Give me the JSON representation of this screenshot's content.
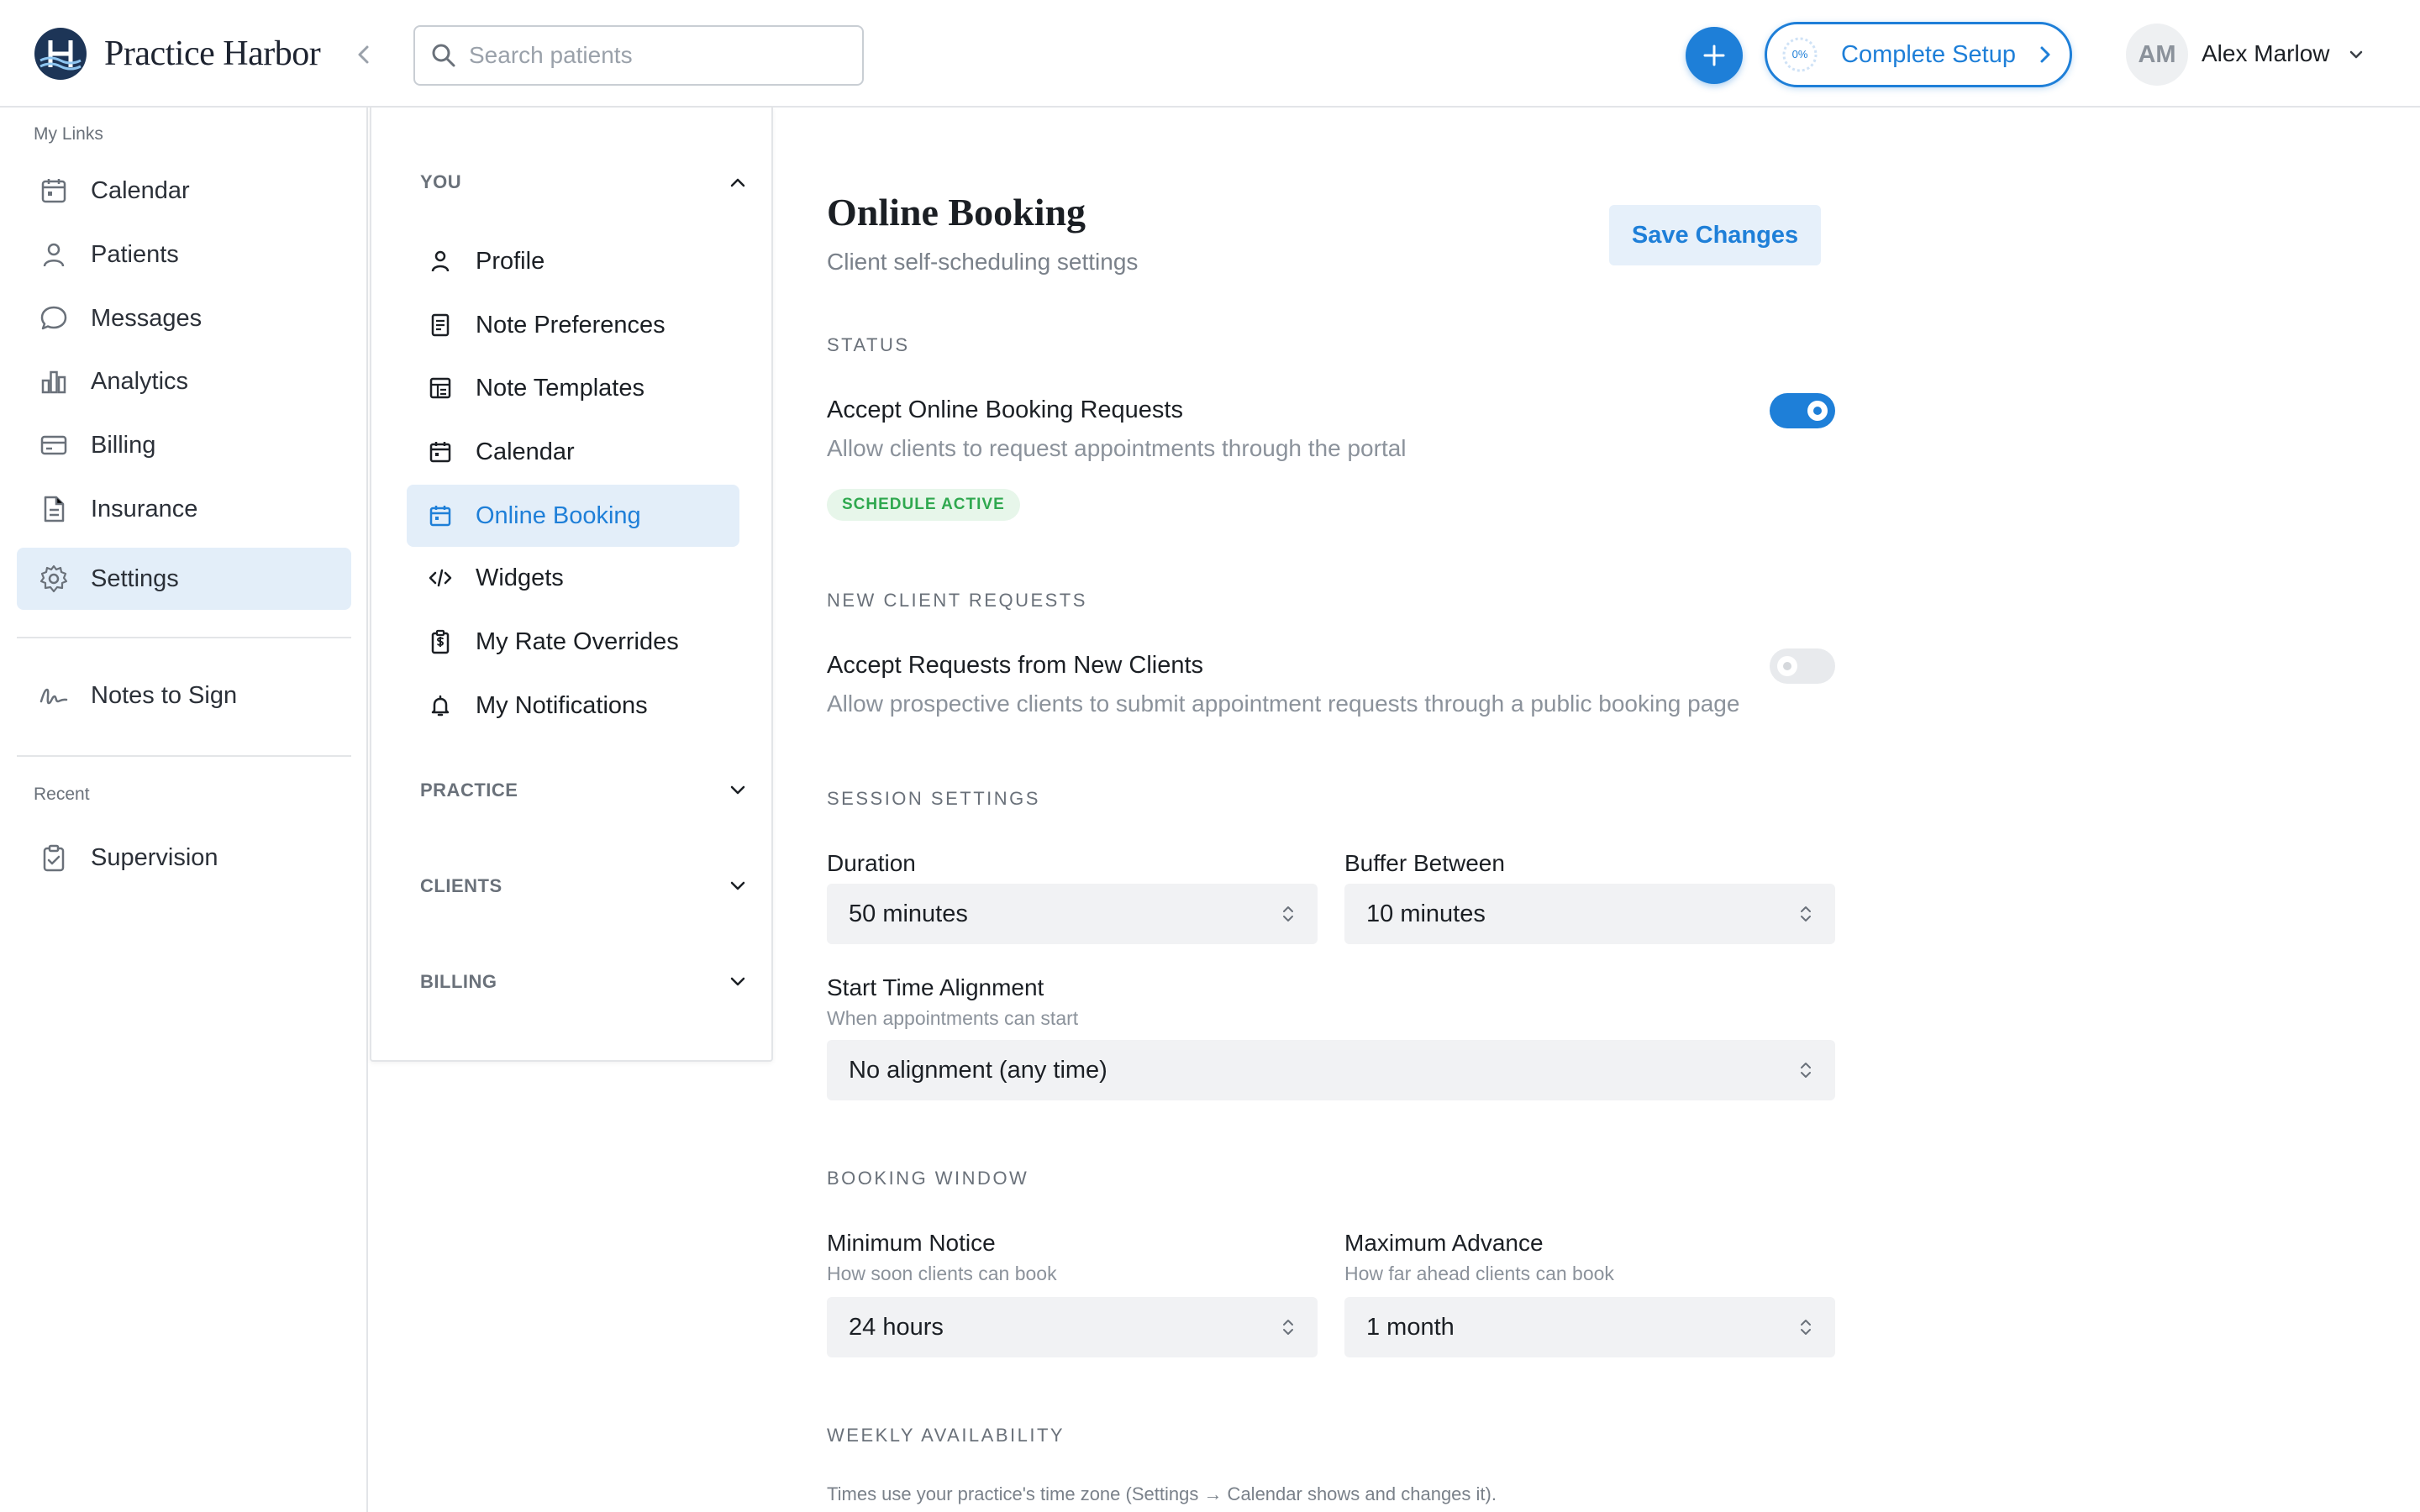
{
  "app": {
    "brand_name": "Practice Harbor",
    "accent_color": "#1e7fd8"
  },
  "topbar": {
    "search_placeholder": "Search patients",
    "setup_progress": "0%",
    "setup_label": "Complete Setup",
    "user_initials": "AM",
    "user_name": "Alex Marlow"
  },
  "sidebar": {
    "my_links_label": "My Links",
    "items": [
      {
        "label": "Calendar",
        "icon": "calendar-icon"
      },
      {
        "label": "Patients",
        "icon": "user-icon"
      },
      {
        "label": "Messages",
        "icon": "message-icon"
      },
      {
        "label": "Analytics",
        "icon": "bar-chart-icon"
      },
      {
        "label": "Billing",
        "icon": "card-icon"
      },
      {
        "label": "Insurance",
        "icon": "document-icon"
      },
      {
        "label": "Settings",
        "icon": "gear-icon",
        "active": true
      }
    ],
    "notes_to_sign": "Notes to Sign",
    "recent_label": "Recent",
    "recent_items": [
      {
        "label": "Supervision",
        "icon": "clipboard-icon"
      }
    ]
  },
  "settings_nav": {
    "sections": {
      "you": "YOU",
      "practice": "PRACTICE",
      "clients": "CLIENTS",
      "billing": "BILLING"
    },
    "you_items": [
      {
        "label": "Profile",
        "icon": "user-icon"
      },
      {
        "label": "Note Preferences",
        "icon": "note-icon"
      },
      {
        "label": "Note Templates",
        "icon": "template-icon"
      },
      {
        "label": "Calendar",
        "icon": "calendar-icon"
      },
      {
        "label": "Online Booking",
        "icon": "calendar-icon",
        "active": true
      },
      {
        "label": "Widgets",
        "icon": "code-icon"
      },
      {
        "label": "My Rate Overrides",
        "icon": "dollar-clipboard-icon"
      },
      {
        "label": "My Notifications",
        "icon": "bell-icon"
      }
    ]
  },
  "main": {
    "title": "Online Booking",
    "subtitle": "Client self-scheduling settings",
    "save_label": "Save Changes",
    "status": {
      "heading": "STATUS",
      "title": "Accept Online Booking Requests",
      "desc": "Allow clients to request appointments through the portal",
      "enabled": true,
      "badge": "SCHEDULE ACTIVE"
    },
    "new_clients": {
      "heading": "NEW CLIENT REQUESTS",
      "title": "Accept Requests from New Clients",
      "desc": "Allow prospective clients to submit appointment requests through a public booking page",
      "enabled": false
    },
    "session": {
      "heading": "SESSION SETTINGS",
      "duration_label": "Duration",
      "duration_value": "50 minutes",
      "buffer_label": "Buffer Between",
      "buffer_value": "10 minutes",
      "alignment_label": "Start Time Alignment",
      "alignment_hint": "When appointments can start",
      "alignment_value": "No alignment (any time)"
    },
    "booking_window": {
      "heading": "BOOKING WINDOW",
      "min_label": "Minimum Notice",
      "min_hint": "How soon clients can book",
      "min_value": "24 hours",
      "max_label": "Maximum Advance",
      "max_hint": "How far ahead clients can book",
      "max_value": "1 month"
    },
    "weekly": {
      "heading": "WEEKLY AVAILABILITY",
      "note": "Times use your practice's time zone (Settings → Calendar shows and changes it)."
    }
  }
}
